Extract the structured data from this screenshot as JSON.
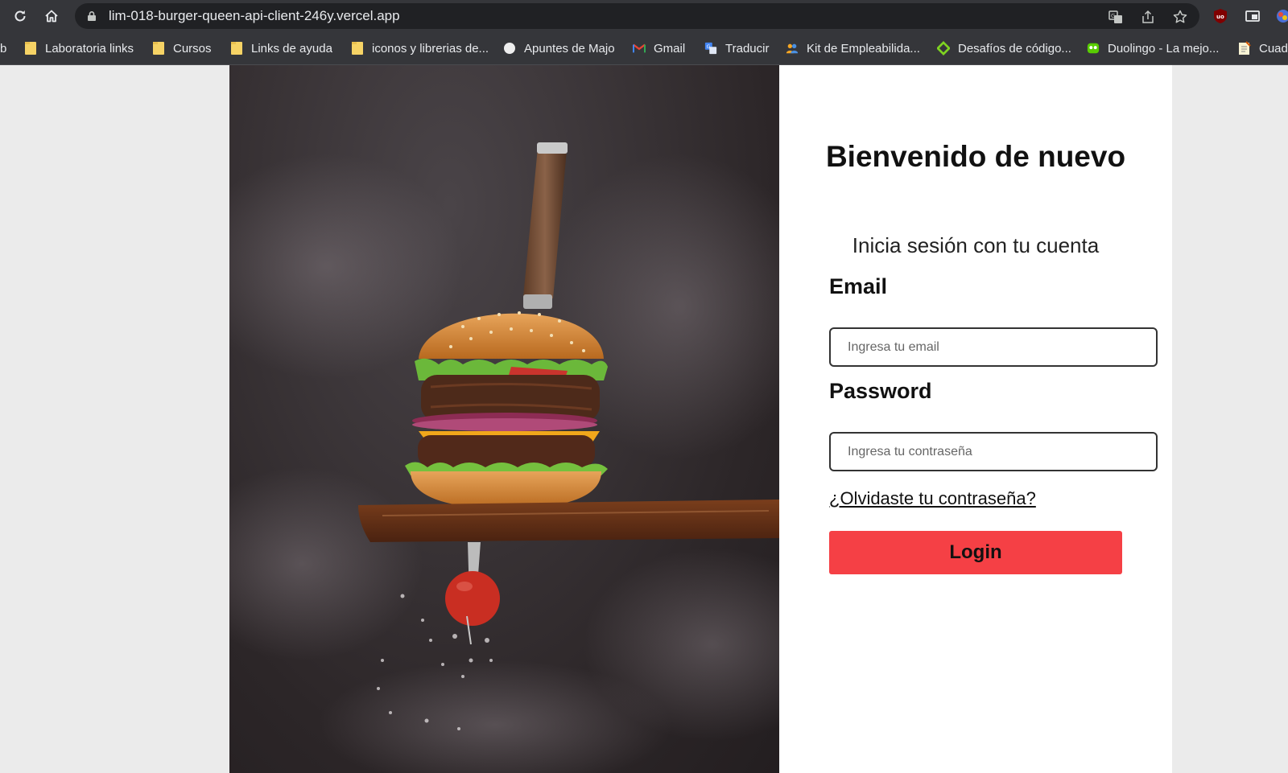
{
  "browser": {
    "url": "lim-018-burger-queen-api-client-246y.vercel.app",
    "toolbar_icons": [
      "reload-icon",
      "home-icon",
      "lock-icon",
      "translate-icon",
      "share-icon",
      "bookmark-star-icon",
      "ublock-icon",
      "window-icon",
      "extension-icon"
    ]
  },
  "bookmarks": [
    {
      "label": "b",
      "icon": "none"
    },
    {
      "label": "Laboratoria links",
      "icon": "folder-icon"
    },
    {
      "label": "Cursos",
      "icon": "folder-icon"
    },
    {
      "label": "Links de ayuda",
      "icon": "folder-icon"
    },
    {
      "label": "iconos y librerias de...",
      "icon": "folder-icon"
    },
    {
      "label": "Apuntes de Majo",
      "icon": "circle-icon"
    },
    {
      "label": "Gmail",
      "icon": "gmail-icon"
    },
    {
      "label": "Traducir",
      "icon": "translate-icon"
    },
    {
      "label": "Kit de Empleabilida...",
      "icon": "people-icon"
    },
    {
      "label": "Desafíos de código...",
      "icon": "diamond-icon"
    },
    {
      "label": "Duolingo - La mejo...",
      "icon": "duolingo-icon"
    },
    {
      "label": "Cuad",
      "icon": "notepad-icon"
    }
  ],
  "login": {
    "title": "Bienvenido de nuevo",
    "subtitle": "Inicia sesión con tu cuenta",
    "email_label": "Email",
    "email_placeholder": "Ingresa tu email",
    "email_value": "",
    "password_label": "Password",
    "password_placeholder": "Ingresa tu contraseña",
    "password_value": "",
    "forgot_link": "¿Olvidaste tu contraseña?",
    "submit_label": "Login"
  },
  "colors": {
    "login_button": "#f54045",
    "browser_chrome": "#35363a",
    "omnibox": "#202124"
  }
}
